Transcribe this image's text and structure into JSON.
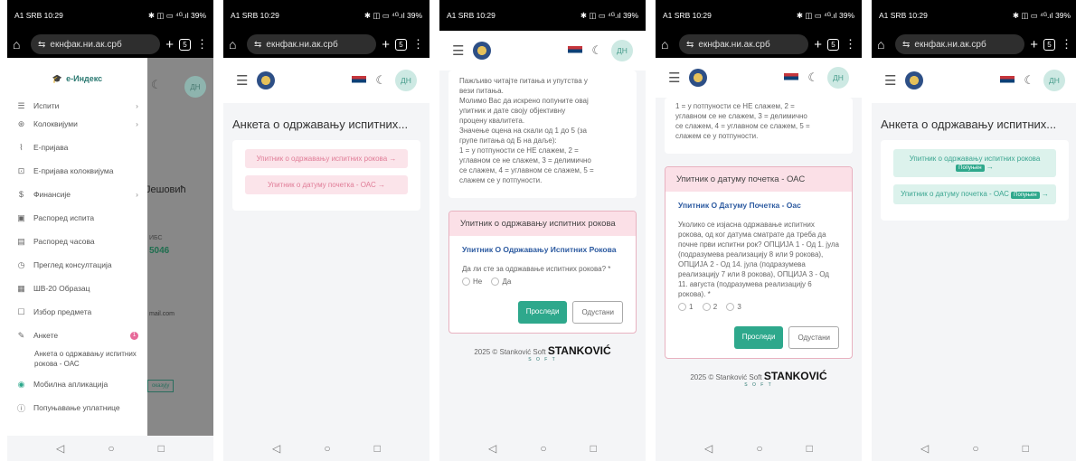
{
  "status": {
    "carrier": "A1 SRB 10:29",
    "icons_left": "▣ ◙ ◎",
    "icons_right": "✱ ◫ ▭ ⁴ᴳ.ıl",
    "battery": "39%"
  },
  "browser": {
    "url": "екнфак.ни.ак.срб",
    "tabs_count": "5"
  },
  "user": {
    "initials": "ДН"
  },
  "sidebar": {
    "brand": "е-Индекс",
    "items": [
      {
        "label": "Испити",
        "chev": "›"
      },
      {
        "label": "Колоквијуми",
        "chev": "›"
      },
      {
        "label": "Е-пријава"
      },
      {
        "label": "Е-пријава колоквијума"
      },
      {
        "label": "Финансије",
        "chev": "›"
      },
      {
        "label": "Распоред испита"
      },
      {
        "label": "Распоред часова"
      },
      {
        "label": "Преглед консултација"
      },
      {
        "label": "ШВ-20 Образац"
      },
      {
        "label": "Избор предмета"
      },
      {
        "label": "Анкете",
        "badge": "1"
      },
      {
        "label": "Мобилна апликација"
      },
      {
        "label": "Попуњавање уплатнице"
      }
    ],
    "subitem": "Анкета о одржавању испитних рокова - ОАС"
  },
  "bg_peek": {
    "name": "Јешовић",
    "label": "ИБС",
    "num": "5046",
    "email": "mail.com",
    "btn": "оказују"
  },
  "survey": {
    "title": "Анкета о одржавању испитних...",
    "q1": "Упитник о одржавању испитних рокова",
    "q2": "Упитник о датуму почетка - ОАС",
    "filled_badge": "Попуњен",
    "arrow": "→"
  },
  "intro": {
    "lines": [
      "Пажљиво читајте питања и упутства у",
      "вези питања.",
      "Молимо Вас да искрено попуните овај",
      "упитник и дате своју објективну",
      "процену квалитета.",
      "Значење оцена на скали од 1 до 5 (за",
      "групе питања од Б на даље):",
      "1 = у потпуности се НЕ слажем, 2 =",
      "углавном се не слажем, 3 = делимично",
      "се слажем, 4 = углавном се слажем, 5 =",
      "слажем се у потпуности."
    ],
    "tail_lines": [
      "1 = у потпуности се НЕ слажем, 2 =",
      "углавном се не слажем, 3 = делимично",
      "се слажем, 4 = углавном се слажем, 5 =",
      "слажем се у потпуности."
    ]
  },
  "form1": {
    "header": "Упитник о одржавању испитних рокова",
    "subtitle": "Упитник О Одржавању Испитних Рокова",
    "question": "Да ли сте за одржавање испитних рокова? *",
    "opt_no": "Не",
    "opt_yes": "Да"
  },
  "form2": {
    "header": "Упитник о датуму почетка - ОАС",
    "subtitle": "Упитник О Датуму Почетка - Оас",
    "question": "Уколико се изјасна одржавање испитних рокова, од ког датума сматрате да треба да почне први испитни рок? ОПЦИЈА 1 - Од 1. јула (подразумева реализацију 8 или 9 рокова), ОПЦИЈА 2 - Од 14. јула (подразумева реализацију 7 или 8 рокова), ОПЦИЈА 3 - Од 11. августа (подразумева реализацију 6 рокова). *",
    "opts": [
      "1",
      "2",
      "3"
    ]
  },
  "buttons": {
    "submit": "Проследи",
    "cancel": "Одустани"
  },
  "footer": {
    "copy": "2025 © Stanković Soft",
    "brand": "STANKOVIĆ",
    "soft": "S O F T"
  }
}
